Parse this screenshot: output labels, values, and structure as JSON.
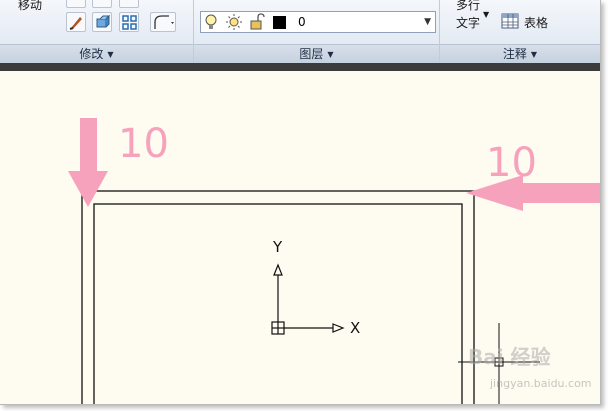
{
  "ribbon": {
    "modify": {
      "move_label": "移动",
      "title": "修改"
    },
    "layers": {
      "current_layer": "0",
      "title": "图层"
    },
    "annotation": {
      "multiline_label": "多行",
      "text_label": "文字",
      "table_label": "表格",
      "title": "注释"
    }
  },
  "drawing": {
    "top_offset_label": "10",
    "right_offset_label": "10",
    "y_axis_label": "Y",
    "x_axis_label": "X"
  },
  "watermark": {
    "main": "Bai 经验",
    "sub": "jingyan.baidu.com"
  },
  "colors": {
    "annotation_pink": "#f7a2bc",
    "canvas_bg": "#fefcf0",
    "ribbon_bg": "#e6ecf4"
  },
  "icons": [
    "brush-icon",
    "3d-move-icon",
    "grid-array-icon",
    "fillet-icon",
    "lightbulb-icon",
    "sun-icon",
    "unlock-icon",
    "color-swatch-icon",
    "table-icon",
    "ucs-icon"
  ]
}
